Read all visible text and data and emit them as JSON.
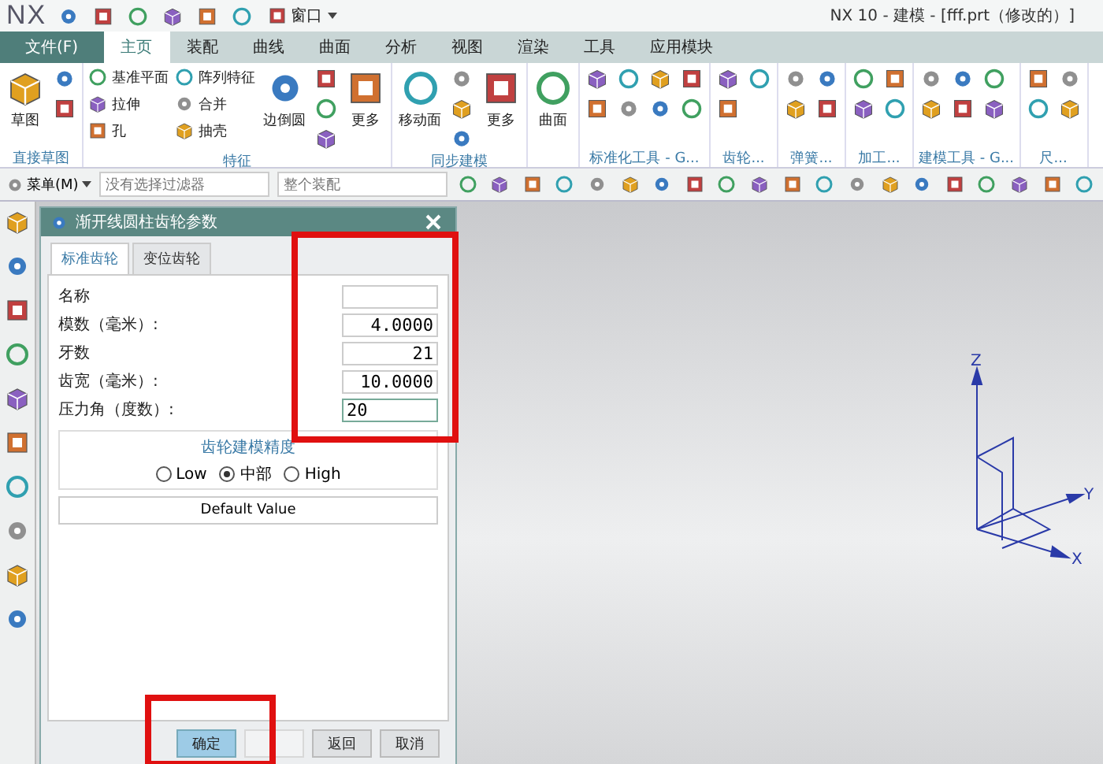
{
  "title_bar": {
    "logo": "NX",
    "window_menu": "窗口",
    "title": "NX 10 - 建模 - [fff.prt（修改的）]"
  },
  "menu_tabs": [
    {
      "label": "文件(F)",
      "kind": "file",
      "selected": false
    },
    {
      "label": "主页",
      "kind": "tab",
      "selected": true
    },
    {
      "label": "装配",
      "kind": "tab",
      "selected": false
    },
    {
      "label": "曲线",
      "kind": "tab",
      "selected": false
    },
    {
      "label": "曲面",
      "kind": "tab",
      "selected": false
    },
    {
      "label": "分析",
      "kind": "tab",
      "selected": false
    },
    {
      "label": "视图",
      "kind": "tab",
      "selected": false
    },
    {
      "label": "渲染",
      "kind": "tab",
      "selected": false
    },
    {
      "label": "工具",
      "kind": "tab",
      "selected": false
    },
    {
      "label": "应用模块",
      "kind": "tab",
      "selected": false
    }
  ],
  "ribbon": {
    "groups": [
      {
        "label": "直接草图",
        "kind": "features",
        "items": [
          {
            "kind": "large",
            "label": "草图"
          },
          {
            "kind": "icon"
          },
          {
            "kind": "icon"
          }
        ]
      },
      {
        "label": "特征",
        "kind": "features",
        "items": [
          {
            "kind": "small",
            "label": "基准平面"
          },
          {
            "kind": "small",
            "label": "拉伸"
          },
          {
            "kind": "small",
            "label": "孔"
          },
          {
            "kind": "small",
            "label": "阵列特征"
          },
          {
            "kind": "small",
            "label": "合并"
          },
          {
            "kind": "small",
            "label": "抽壳"
          },
          {
            "kind": "large",
            "label": "边倒圆"
          },
          {
            "kind": "icon"
          },
          {
            "kind": "icon"
          },
          {
            "kind": "icon"
          },
          {
            "kind": "large",
            "label": "更多"
          }
        ]
      },
      {
        "label": "同步建模",
        "kind": "features",
        "items": [
          {
            "kind": "large",
            "label": "移动面"
          },
          {
            "kind": "icon"
          },
          {
            "kind": "icon"
          },
          {
            "kind": "icon"
          },
          {
            "kind": "large",
            "label": "更多"
          }
        ]
      },
      {
        "kind": "features",
        "items": [
          {
            "kind": "large",
            "label": "曲面"
          }
        ]
      },
      {
        "label": "标准化工具 - G...",
        "kind": "tools",
        "items": [
          {
            "kind": "icon"
          },
          {
            "kind": "icon"
          },
          {
            "kind": "icon"
          },
          {
            "kind": "icon"
          },
          {
            "kind": "icon"
          },
          {
            "kind": "icon"
          },
          {
            "kind": "icon"
          },
          {
            "kind": "icon"
          }
        ]
      },
      {
        "label": "齿轮...",
        "kind": "tools",
        "items": [
          {
            "kind": "icon"
          },
          {
            "kind": "icon"
          },
          {
            "kind": "icon"
          }
        ]
      },
      {
        "label": "弹簧...",
        "kind": "tools",
        "items": [
          {
            "kind": "icon"
          },
          {
            "kind": "icon"
          },
          {
            "kind": "icon"
          },
          {
            "kind": "icon"
          }
        ]
      },
      {
        "label": "加工...",
        "kind": "tools",
        "items": [
          {
            "kind": "icon"
          },
          {
            "kind": "icon"
          },
          {
            "kind": "icon"
          },
          {
            "kind": "icon"
          }
        ]
      },
      {
        "label": "建模工具 - G...",
        "kind": "tools",
        "items": [
          {
            "kind": "icon"
          },
          {
            "kind": "icon"
          },
          {
            "kind": "icon"
          },
          {
            "kind": "icon"
          },
          {
            "kind": "icon"
          },
          {
            "kind": "icon"
          }
        ]
      },
      {
        "label": "尺...",
        "kind": "tools",
        "items": [
          {
            "kind": "icon"
          },
          {
            "kind": "icon"
          },
          {
            "kind": "icon"
          },
          {
            "kind": "icon"
          }
        ]
      }
    ]
  },
  "toolbar": {
    "menu_button": "菜单(M)",
    "filters": [
      {
        "placeholder": "没有选择过滤器"
      },
      {
        "placeholder": "整个装配"
      }
    ]
  },
  "dialog": {
    "title": "渐开线圆柱齿轮参数",
    "tabs": [
      {
        "label": "标准齿轮",
        "selected": true
      },
      {
        "label": "变位齿轮",
        "selected": false
      }
    ],
    "fields": [
      {
        "label": "名称",
        "focused": false
      },
      {
        "label": "模数（毫米）:",
        "value": "4.0000",
        "focused": false
      },
      {
        "label": "牙数",
        "value": "21",
        "focused": false
      },
      {
        "label": "齿宽（毫米）:",
        "value": "10.0000",
        "focused": false
      },
      {
        "label": "压力角（度数）:",
        "value": "20",
        "focused": true
      }
    ],
    "precision": {
      "title": "齿轮建模精度",
      "options": [
        {
          "label": "Low",
          "selected": false
        },
        {
          "label": "中部",
          "selected": true
        },
        {
          "label": "High",
          "selected": false
        }
      ]
    },
    "default_button": "Default Value",
    "buttons": [
      {
        "label": "确定",
        "kind": "primary",
        "disabled": false
      },
      {
        "kind": "normal",
        "disabled": true
      },
      {
        "label": "返回",
        "kind": "normal",
        "disabled": false
      },
      {
        "label": "取消",
        "kind": "normal",
        "disabled": false
      }
    ]
  },
  "viewport": {
    "axes": {
      "z": "Z",
      "y": "Y",
      "x": "X"
    }
  }
}
